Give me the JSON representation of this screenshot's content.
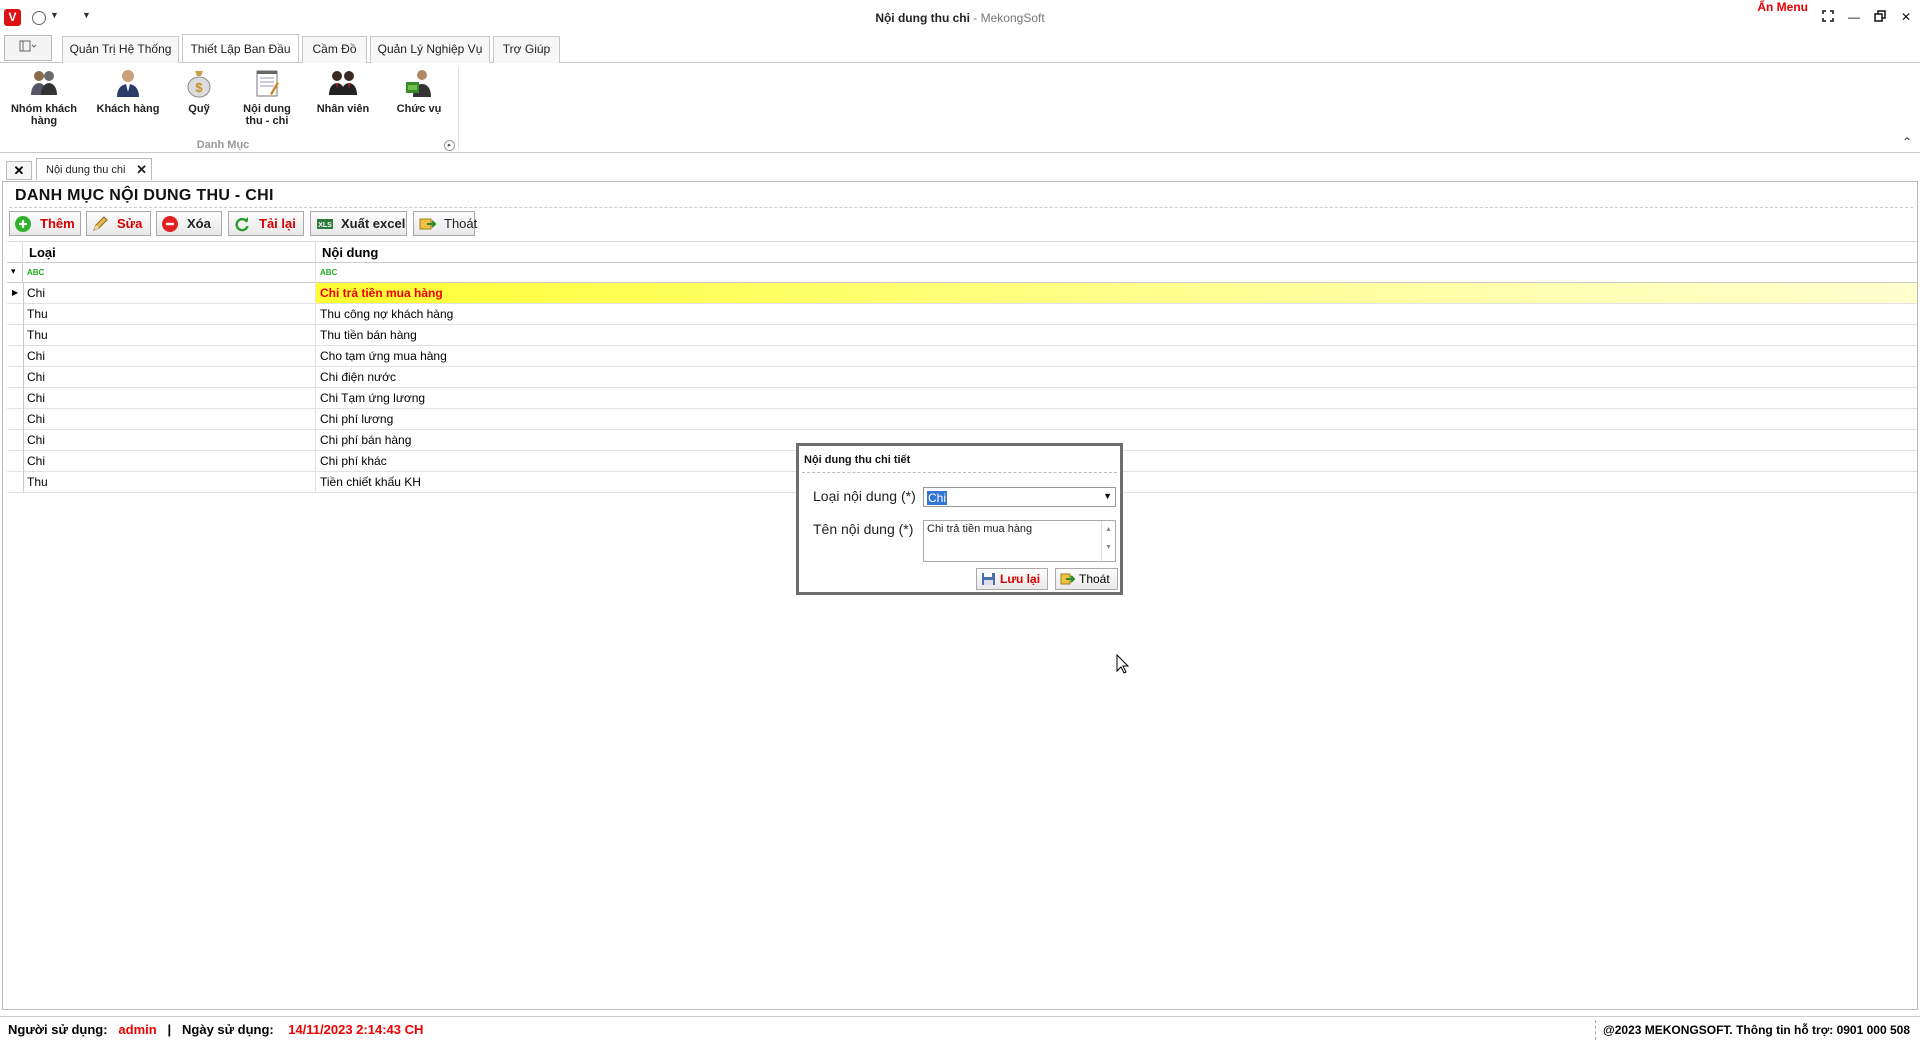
{
  "window": {
    "title": "Nội dung thu chi",
    "brand": " - MekongSoft",
    "hide_menu": "Ẩn Menu",
    "logo_letter": "V"
  },
  "ribbon": {
    "tabs": [
      {
        "label": "Quản Trị Hệ Thống"
      },
      {
        "label": "Thiết Lập Ban Đầu"
      },
      {
        "label": "Cầm Đồ"
      },
      {
        "label": "Quản Lý Nghiệp Vụ"
      },
      {
        "label": "Trợ Giúp"
      }
    ],
    "items": [
      {
        "label": "Nhóm khách hàng",
        "icon": "customer-group-icon"
      },
      {
        "label": "Khách hàng",
        "icon": "customer-icon"
      },
      {
        "label": "Quỹ",
        "icon": "money-bag-icon"
      },
      {
        "label": "Nội dung thu - chi",
        "icon": "notepad-icon"
      },
      {
        "label": "Nhân viên",
        "icon": "employees-icon"
      },
      {
        "label": "Chức vụ",
        "icon": "position-icon"
      }
    ],
    "group_label": "Danh Mục"
  },
  "doc_tabs": {
    "active": "Nội dung thu chi"
  },
  "page": {
    "heading": "DANH MỤC NỘI DUNG THU - CHI"
  },
  "toolbar": {
    "add": "Thêm",
    "edit": "Sửa",
    "delete": "Xóa",
    "reload": "Tải lại",
    "export": "Xuất excel",
    "exit": "Thoát"
  },
  "grid": {
    "columns": [
      "Loại",
      "Nội dung"
    ],
    "filter_icon": "ABC",
    "rows": [
      {
        "type": "Chi",
        "content": "Chi trả tiền mua hàng"
      },
      {
        "type": "Thu",
        "content": "Thu công nợ khách hàng"
      },
      {
        "type": "Thu",
        "content": "Thu tiền bán hàng"
      },
      {
        "type": "Chi",
        "content": "Cho tạm ứng mua hàng"
      },
      {
        "type": "Chi",
        "content": "Chi điện nước"
      },
      {
        "type": "Chi",
        "content": "Chi Tạm ứng lương"
      },
      {
        "type": "Chi",
        "content": "Chi phí lương"
      },
      {
        "type": "Chi",
        "content": "Chi phí bán hàng"
      },
      {
        "type": "Chi",
        "content": "Chi phí khác"
      },
      {
        "type": "Thu",
        "content": "Tiền chiết khấu KH"
      }
    ]
  },
  "dialog": {
    "title": "Nội dung thu chi tiết",
    "type_label": "Loại nội dung (*)",
    "type_value": "Chi",
    "name_label": "Tên nội dung (*)",
    "name_value": "Chi trả tiền mua hàng",
    "save": "Lưu lại",
    "exit": "Thoát"
  },
  "status": {
    "user_label": "Người sử dụng:",
    "user": "admin",
    "date_label": "Ngày sử dụng:",
    "date": "14/11/2023 2:14:43 CH",
    "copyright": "@2023 MEKONGSOFT. Thông tin hỗ trợ: 0901 000 508"
  },
  "colors": {
    "accent_red": "#e00000",
    "highlight_yellow": "#ffff33",
    "selection_blue": "#3375d6"
  }
}
